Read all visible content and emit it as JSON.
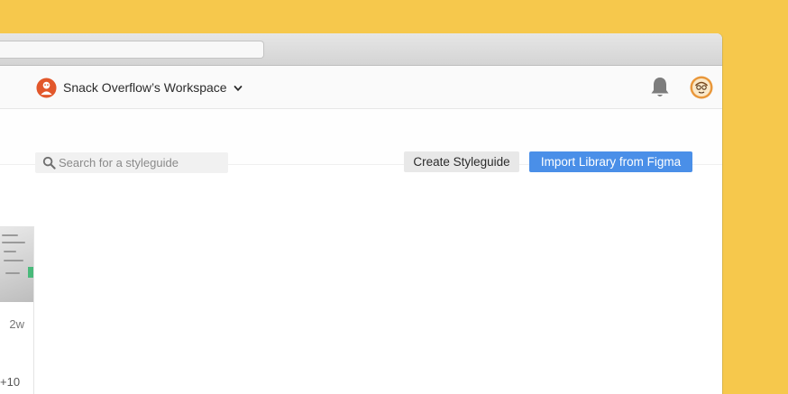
{
  "workspace": {
    "name": "Snack Overflow’s Workspace",
    "logo_icon": "workspace-logo-icon",
    "chevron_icon": "chevron-down-icon"
  },
  "header": {
    "notifications_icon": "bell-icon",
    "avatar_icon": "avatar"
  },
  "toolbar": {
    "search_placeholder": "Search for a styleguide",
    "create_label": "Create Styleguide",
    "import_label": "Import Library from Figma"
  },
  "styleguide_card": {
    "updated": "2w",
    "more_count": "+10"
  },
  "colors": {
    "background": "#f6c84c",
    "accent": "#4a8fe8",
    "logo": "#e2572b"
  }
}
